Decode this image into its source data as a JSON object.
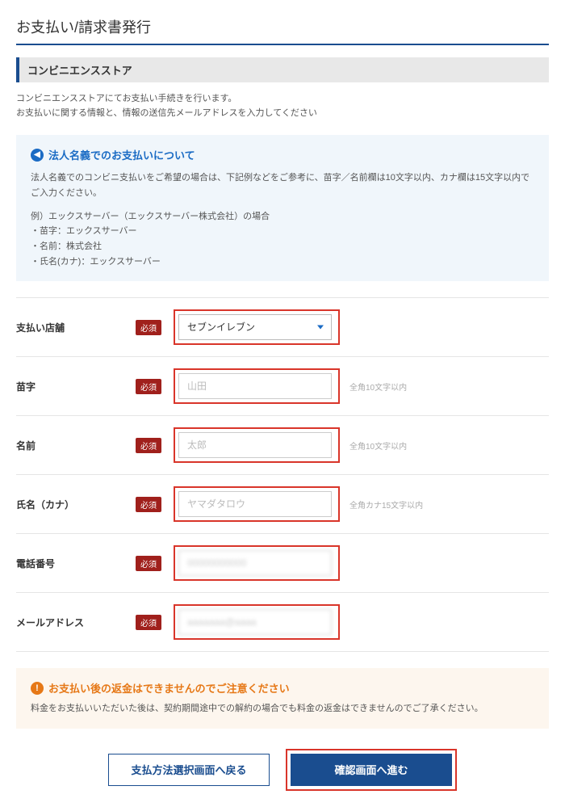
{
  "page": {
    "title": "お支払い/請求書発行"
  },
  "section": {
    "header": "コンビニエンスストア"
  },
  "intro": {
    "line1": "コンビニエンスストアにてお支払い手続きを行います。",
    "line2": "お支払いに関する情報と、情報の送信先メールアドレスを入力してください"
  },
  "infoBox": {
    "title": "法人名義でのお支払いについて",
    "body1": "法人名義でのコンビニ支払いをご希望の場合は、下記例などをご参考に、苗字／名前欄は10文字以内、カナ欄は15文字以内でご入力ください。",
    "example_header": "例）エックスサーバー（エックスサーバー株式会社）の場合",
    "example_line1": "・苗字：エックスサーバー",
    "example_line2": "・名前：株式会社",
    "example_line3": "・氏名(カナ)：エックスサーバー"
  },
  "form": {
    "required_label": "必須",
    "store": {
      "label": "支払い店舗",
      "selected": "セブンイレブン"
    },
    "lastname": {
      "label": "苗字",
      "placeholder": "山田",
      "hint": "全角10文字以内"
    },
    "firstname": {
      "label": "名前",
      "placeholder": "太郎",
      "hint": "全角10文字以内"
    },
    "kana": {
      "label": "氏名（カナ）",
      "placeholder": "ヤマダタロウ",
      "hint": "全角カナ15文字以内"
    },
    "phone": {
      "label": "電話番号",
      "value": "00000000000"
    },
    "email": {
      "label": "メールアドレス",
      "value": "aaaaaaa@aaaa"
    }
  },
  "warning": {
    "title": "お支払い後の返金はできませんのでご注意ください",
    "body": "料金をお支払いいただいた後は、契約期間途中での解約の場合でも料金の返金はできませんのでご了承ください。"
  },
  "buttons": {
    "back": "支払方法選択画面へ戻る",
    "confirm": "確認画面へ進む"
  }
}
